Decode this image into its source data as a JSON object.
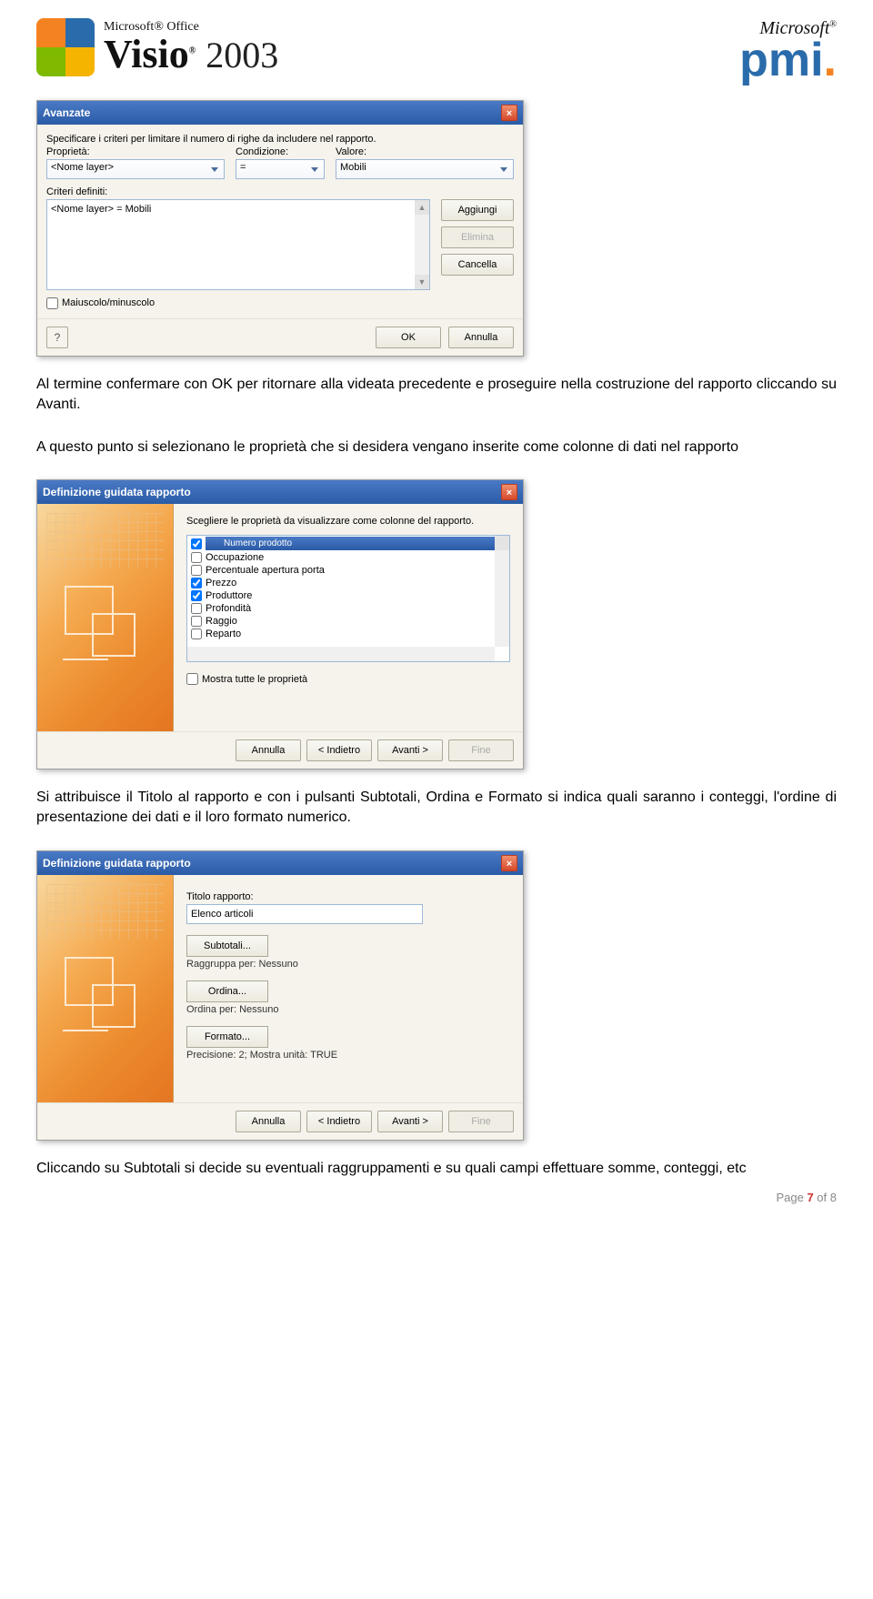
{
  "header": {
    "mso": "Microsoft® Office",
    "visio": "Visio",
    "year": "2003",
    "pmi_m": "Microsoft",
    "pmi_r": "®",
    "pmi": "pmi"
  },
  "dlg1": {
    "title": "Avanzate",
    "instruction": "Specificare i criteri per limitare il numero di righe da includere nel rapporto.",
    "lbl_prop": "Proprietà:",
    "lbl_cond": "Condizione:",
    "lbl_val": "Valore:",
    "val_prop": "<Nome layer>",
    "val_cond": "=",
    "val_val": "Mobili",
    "lbl_criteri": "Criteri definiti:",
    "criteri_item": "<Nome layer> = Mobili",
    "btn_aggiungi": "Aggiungi",
    "btn_elimina": "Elimina",
    "btn_cancella": "Cancella",
    "chk_maiusc": "Maiuscolo/minuscolo",
    "btn_ok": "OK",
    "btn_annulla": "Annulla"
  },
  "para1": "Al termine confermare con OK per ritornare alla videata precedente e proseguire nella costruzione del rapporto cliccando su Avanti.",
  "para2": "A questo punto si selezionano le proprietà che si desidera vengano inserite come colonne di dati nel rapporto",
  "dlg2": {
    "title": "Definizione guidata rapporto",
    "instruction": "Scegliere le proprietà da visualizzare come colonne del rapporto.",
    "items": [
      {
        "checked": true,
        "label": "Numero prodotto",
        "hl": true
      },
      {
        "checked": false,
        "label": "Occupazione"
      },
      {
        "checked": false,
        "label": "Percentuale apertura porta"
      },
      {
        "checked": true,
        "label": "Prezzo"
      },
      {
        "checked": true,
        "label": "Produttore"
      },
      {
        "checked": false,
        "label": "Profondità"
      },
      {
        "checked": false,
        "label": "Raggio"
      },
      {
        "checked": false,
        "label": "Reparto"
      }
    ],
    "chk_mostra": "Mostra tutte le proprietà",
    "btn_annulla": "Annulla",
    "btn_indietro": "< Indietro",
    "btn_avanti": "Avanti >",
    "btn_fine": "Fine"
  },
  "para3": "Si attribuisce il Titolo al rapporto e con i pulsanti Subtotali, Ordina e Formato si indica quali saranno i conteggi, l'ordine di presentazione dei dati e il loro formato numerico.",
  "dlg3": {
    "title": "Definizione guidata rapporto",
    "lbl_titolo": "Titolo rapporto:",
    "val_titolo": "Elenco articoli",
    "btn_subtotali": "Subtotali...",
    "note_raggr": "Raggruppa per: Nessuno",
    "btn_ordina": "Ordina...",
    "note_ordina": "Ordina per: Nessuno",
    "btn_formato": "Formato...",
    "note_formato": "Precisione: 2;  Mostra unità: TRUE",
    "btn_annulla": "Annulla",
    "btn_indietro": "< Indietro",
    "btn_avanti": "Avanti >",
    "btn_fine": "Fine"
  },
  "para4": "Cliccando su Subtotali si decide su eventuali raggruppamenti e su quali campi effettuare somme, conteggi, etc",
  "footer": {
    "page_label": "Page ",
    "cur": "7",
    "of": " of ",
    "tot": "8"
  }
}
